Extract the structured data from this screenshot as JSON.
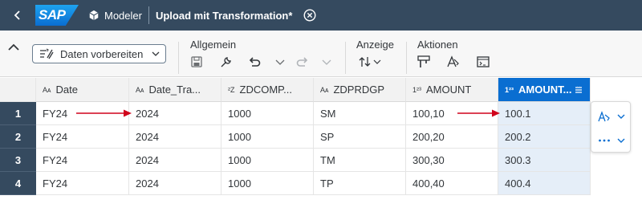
{
  "shell": {
    "logo": "SAP",
    "app": "Modeler",
    "title": "Upload mit Transformation",
    "modified": "*"
  },
  "toolbar": {
    "prepare_label": "Daten vorbereiten",
    "groups": {
      "general": "Allgemein",
      "view": "Anzeige",
      "actions": "Aktionen"
    }
  },
  "grid": {
    "columns": [
      {
        "type_icon": "Aᴀ",
        "label": "Date"
      },
      {
        "type_icon": "Aᴀ",
        "label": "Date_Tra..."
      },
      {
        "type_icon": "²Z",
        "label": "ZDCOMP..."
      },
      {
        "type_icon": "Aᴀ",
        "label": "ZDPRDGP"
      },
      {
        "type_icon": "1²³",
        "label": "AMOUNT"
      },
      {
        "type_icon": "1²³",
        "label": "AMOUNT..."
      }
    ],
    "rows": [
      {
        "num": "1",
        "cells": [
          "FY24",
          "2024",
          "1000",
          "SM",
          "100,10",
          "100.1"
        ]
      },
      {
        "num": "2",
        "cells": [
          "FY24",
          "2024",
          "1000",
          "SP",
          "200,20",
          "200.2"
        ]
      },
      {
        "num": "3",
        "cells": [
          "FY24",
          "2024",
          "1000",
          "TM",
          "300,30",
          "300.3"
        ]
      },
      {
        "num": "4",
        "cells": [
          "FY24",
          "2024",
          "1000",
          "TP",
          "400,40",
          "400.4"
        ]
      }
    ]
  },
  "colors": {
    "shell_bg": "#354a5f",
    "selected_header": "#0a6ed1",
    "selected_cells": "#e5eef8",
    "arrow": "#d0021b"
  }
}
